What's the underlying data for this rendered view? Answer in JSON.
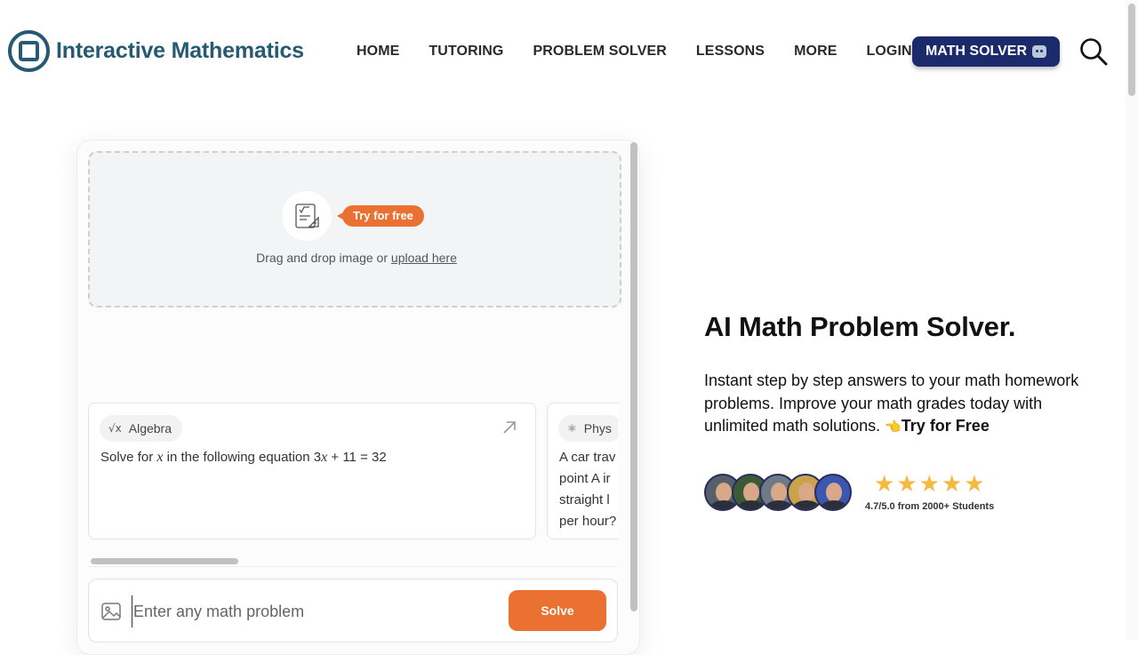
{
  "brand": {
    "name": "Interactive Mathematics"
  },
  "nav": {
    "items": [
      "HOME",
      "TUTORING",
      "PROBLEM SOLVER",
      "LESSONS",
      "MORE",
      "LOGIN"
    ]
  },
  "cta": {
    "label": "MATH SOLVER",
    "icon": "robot-icon"
  },
  "search": {
    "icon": "search-icon"
  },
  "solver": {
    "try_badge": "Try for free",
    "drop_text": "Drag and drop image or ",
    "upload_link": "upload here",
    "cards": [
      {
        "category": "Algebra",
        "category_icon": "sqrt-x-icon",
        "text_before": "Solve for ",
        "var": "x",
        "text_middle": " in the following equation 3",
        "var2": "x",
        "text_after": " + 11 = 32"
      },
      {
        "category": "Phys",
        "category_icon": "atom-icon",
        "lines": [
          "A car trav",
          "point A ir",
          "straight l",
          "per hour?"
        ]
      }
    ],
    "input_placeholder": "Enter any math problem",
    "solve_label": "Solve"
  },
  "hero": {
    "title": "AI Math Problem Solver.",
    "description": "Instant step by step answers to your math homework problems. Improve your math grades today with unlimited math solutions. ",
    "hand_icon": "👈",
    "try_link": "Try for Free"
  },
  "social_proof": {
    "stars": 5,
    "rating_text": "4.7/5.0 from 2000+ Students",
    "avatar_colors": [
      "#55606a",
      "#3b5b35",
      "#6d7a88",
      "#c9a24a",
      "#3c57b0"
    ]
  },
  "colors": {
    "brand": "#265a74",
    "cta_bg": "#1b2a6b",
    "accent": "#ea7131",
    "star": "#f4b93e"
  }
}
